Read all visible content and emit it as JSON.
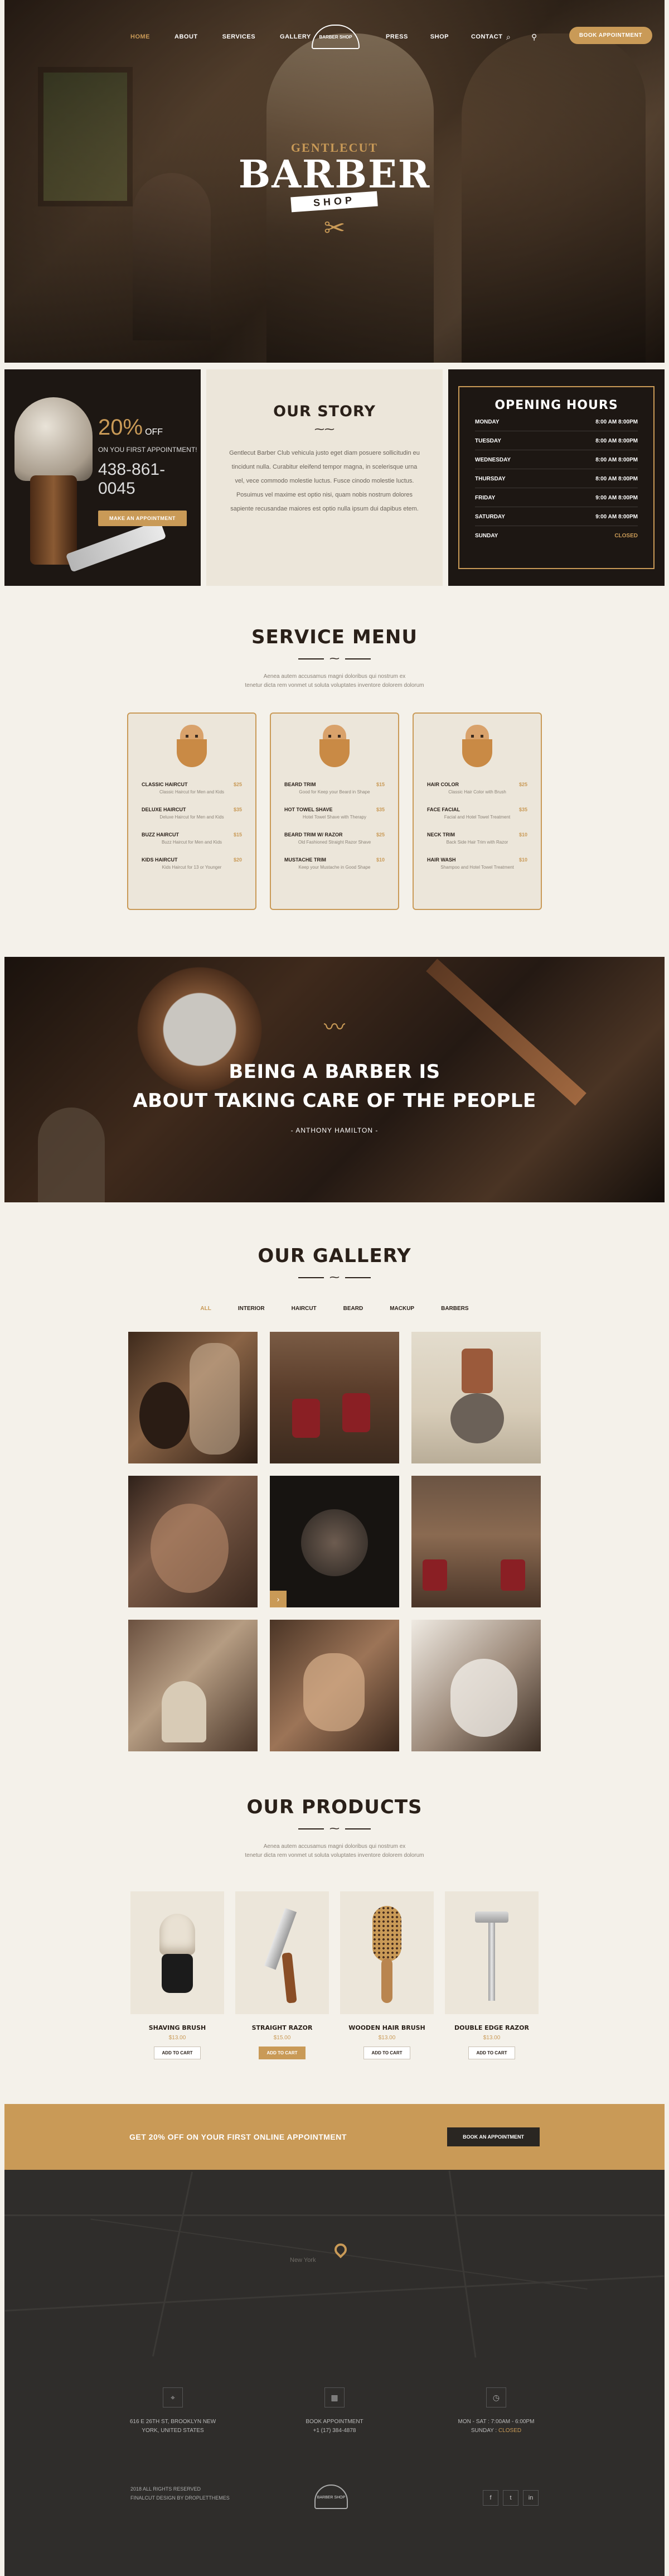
{
  "nav": {
    "left": [
      "HOME",
      "ABOUT",
      "SERVICES",
      "GALLERY"
    ],
    "right": [
      "PRESS",
      "SHOP",
      "CONTACT"
    ],
    "logo_text": "BARBER SHOP",
    "book_label": "BOOK APPOINTMENT",
    "search_icon": "search-icon",
    "cart_icon": "cart-icon"
  },
  "hero": {
    "gentle": "GENTLECUT",
    "barber": "BARBER",
    "shop": "SHOP",
    "scissors": "✂"
  },
  "promo": {
    "percent": "20%",
    "off": "OFF",
    "subtitle": "ON YOU FIRST APPOINTMENT!",
    "phone": "438-861-0045",
    "button": "MAKE AN APPOINTMENT"
  },
  "story": {
    "title": "OUR STORY",
    "text": "Gentlecut Barber Club vehicula justo eget diam posuere sollicitudin eu tincidunt nulla. Curabitur eleifend tempor magna, in scelerisque urna vel, vece commodo molestie luctus. Fusce cinodo molestie luctus. Posuimus vel maxime est optio nisi, quam nobis nostrum dolores sapiente recusandae maiores est optio nulla ipsum dui dapibus etem."
  },
  "hours": {
    "title": "OPENING HOURS",
    "rows": [
      {
        "day": "MONDAY",
        "time": "8:00 AM  8:00PM"
      },
      {
        "day": "TUESDAY",
        "time": "8:00 AM  8:00PM"
      },
      {
        "day": "WEDNESDAY",
        "time": "8:00 AM  8:00PM"
      },
      {
        "day": "THURSDAY",
        "time": "8:00 AM  8:00PM"
      },
      {
        "day": "FRIDAY",
        "time": "9:00 AM  8:00PM"
      },
      {
        "day": "SATURDAY",
        "time": "9:00 AM  8:00PM"
      },
      {
        "day": "SUNDAY",
        "time": "CLOSED"
      }
    ]
  },
  "service": {
    "title": "SERVICE MENU",
    "intro1": "Aenea autem accusamus magni doloribus qui nostrum ex",
    "intro2": "tenetur dicta rem vonmet ut soluta voluptates inventore dolorem dolorum",
    "cards": [
      [
        {
          "name": "CLASSIC HAIRCUT",
          "price": "$25",
          "desc": "Classic Haircut for Men and Kids"
        },
        {
          "name": "DELUXE HAIRCUT",
          "price": "$35",
          "desc": "Deluxe Haircut for Men and Kids"
        },
        {
          "name": "BUZZ HAIRCUT",
          "price": "$15",
          "desc": "Buzz Haircut for Men and Kids"
        },
        {
          "name": "KIDS HAIRCUT",
          "price": "$20",
          "desc": "Kids Haircut for 13 or Younger"
        }
      ],
      [
        {
          "name": "BEARD TRIM",
          "price": "$15",
          "desc": "Good for Keep your Beard in Shape"
        },
        {
          "name": "HOT TOWEL SHAVE",
          "price": "$35",
          "desc": "Hotel Towel Shave with Therapy"
        },
        {
          "name": "BEARD TRIM W/ RAZOR",
          "price": "$25",
          "desc": "Old Fashioned Straight Razor Shave"
        },
        {
          "name": "MUSTACHE TRIM",
          "price": "$10",
          "desc": "Keep your Mustache in Good Shape"
        }
      ],
      [
        {
          "name": "HAIR COLOR",
          "price": "$25",
          "desc": "Classic Hair Color with Brush"
        },
        {
          "name": "FACE FACIAL",
          "price": "$35",
          "desc": "Facial and Hotel Towel Treatment"
        },
        {
          "name": "NECK TRIM",
          "price": "$10",
          "desc": "Back Side Hair Trim with Razor"
        },
        {
          "name": "HAIR WASH",
          "price": "$10",
          "desc": "Shampoo and Hotel Towel Treatment"
        }
      ]
    ]
  },
  "quote": {
    "line1": "BEING A BARBER IS",
    "line2": "ABOUT TAKING CARE OF THE PEOPLE",
    "author": "- ANTHONY HAMILTON -",
    "mustache": "〰"
  },
  "gallery": {
    "title": "OUR GALLERY",
    "filters": [
      "ALL",
      "INTERIOR",
      "HAIRCUT",
      "BEARD",
      "MACKUP",
      "BARBERS"
    ]
  },
  "products": {
    "title": "OUR PRODUCTS",
    "intro1": "Aenea autem accusamus magni doloribus qui nostrum ex",
    "intro2": "tenetur dicta rem vonmet ut soluta voluptates inventore dolorem dolorum",
    "items": [
      {
        "name": "SHAVING BRUSH",
        "price": "$13.00",
        "cart": "ADD TO CART"
      },
      {
        "name": "STRAIGHT RAZOR",
        "price": "$15.00",
        "cart": "ADD TO CART"
      },
      {
        "name": "WOODEN HAIR BRUSH",
        "price": "$13.00",
        "cart": "ADD TO CART"
      },
      {
        "name": "DOUBLE EDGE RAZOR",
        "price": "$13.00",
        "cart": "ADD TO CART"
      }
    ]
  },
  "cta": {
    "text": "GET 20% OFF ON YOUR FIRST ONLINE APPOINTMENT",
    "button": "BOOK AN APPOINTMENT"
  },
  "map": {
    "city": "New York"
  },
  "footer": {
    "address1": "616 E 26TH ST, BROOKLYN NEW",
    "address2": "YORK, UNITED STATES",
    "book1": "BOOK APPOINTMENT",
    "book2": "+1 (17) 384-4878",
    "hours1": "MON - SAT : 7:00AM - 6:00PM",
    "hours2a": "SUNDAY : ",
    "hours2b": "CLOSED",
    "copy1": "2018 ALL RIGHTS RESERVED",
    "copy2": "FINALCUT DESIGN BY DROPLETTHEMES",
    "logo": "BARBER SHOP",
    "social": [
      "f",
      "t",
      "in"
    ]
  },
  "colors": {
    "accent": "#c99a57",
    "dark": "#1d1713",
    "cream": "#f4f1ea"
  }
}
